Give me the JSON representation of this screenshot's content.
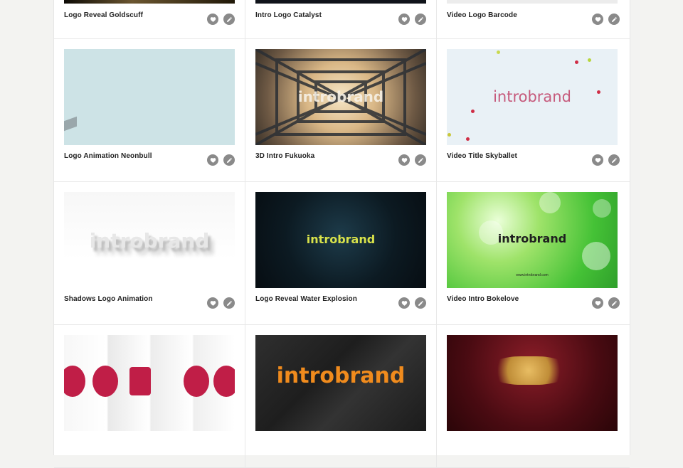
{
  "cards": [
    {
      "title": "Logo Reveal Goldscuff"
    },
    {
      "title": "Intro Logo Catalyst"
    },
    {
      "title": "Video Logo Barcode"
    },
    {
      "title": "Logo Animation Neonbull"
    },
    {
      "title": "3D Intro Fukuoka",
      "brand": "introbrand"
    },
    {
      "title": "Video Title Skyballet",
      "brand": "introbrand"
    },
    {
      "title": "Shadows Logo Animation",
      "brand": "introbrand"
    },
    {
      "title": "Logo Reveal Water Explosion",
      "brand": "introbrand"
    },
    {
      "title": "Video Intro Bokelove",
      "brand": "introbrand",
      "url": "www.introbrand.com"
    },
    {
      "title": ""
    },
    {
      "title": "",
      "brand": "introbrand"
    },
    {
      "title": ""
    }
  ],
  "icons": {
    "favorite": "heart-icon",
    "edit": "pencil-icon"
  }
}
